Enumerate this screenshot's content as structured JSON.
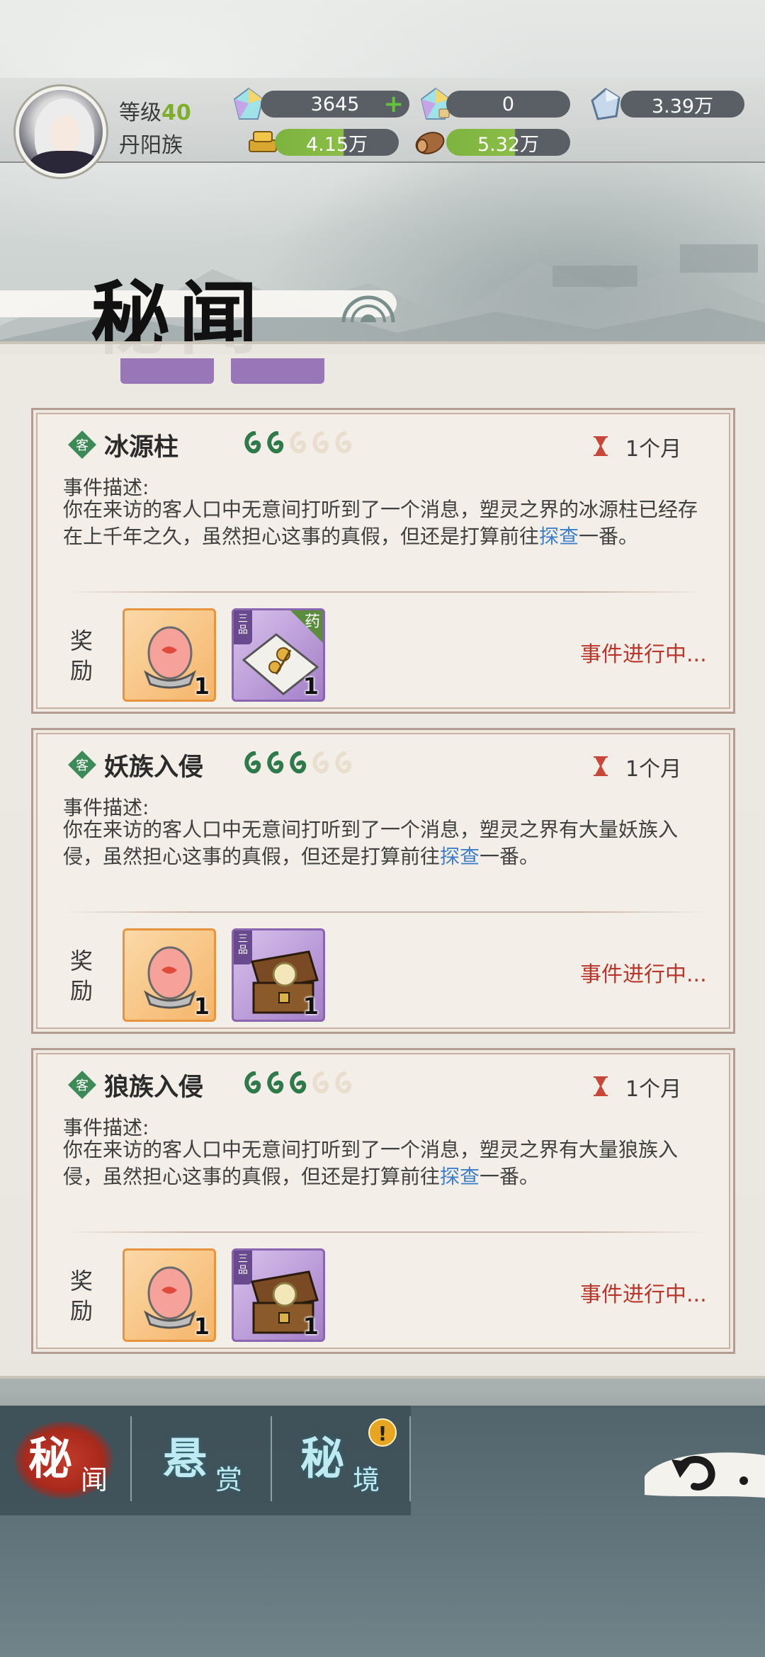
{
  "player": {
    "level_label": "等级",
    "level": "40",
    "clan": "丹阳族"
  },
  "resources": {
    "gem_blue": {
      "value": "3645",
      "icon": "crystal-icon",
      "action": "+"
    },
    "gem_locked": {
      "value": "0",
      "icon": "bound-crystal-icon"
    },
    "spirit_stone": {
      "value": "3.39万",
      "icon": "stone-icon"
    },
    "gold": {
      "value": "4.15万",
      "icon": "gold-ingot-icon"
    },
    "wood": {
      "value": "5.32万",
      "icon": "wood-icon"
    }
  },
  "page": {
    "title": "秘闻"
  },
  "events": [
    {
      "tag": "客",
      "title": "冰源柱",
      "difficulty": 2,
      "difficulty_max": 5,
      "duration": "1个月",
      "desc_label": "事件描述:",
      "desc_before": "你在来访的客人口中无意间打听到了一个消息，塑灵之界的冰源柱已经存在上千年之久，虽然担心这事的真假，但还是打算前往",
      "desc_link": "探查",
      "desc_after": "一番。",
      "reward_label": "奖励",
      "rewards": [
        {
          "type": "stone",
          "qty": "1"
        },
        {
          "type": "herb-bundle",
          "grade": "三品",
          "badge": "药",
          "qty": "1"
        }
      ],
      "status": "事件进行中..."
    },
    {
      "tag": "客",
      "title": "妖族入侵",
      "difficulty": 3,
      "difficulty_max": 5,
      "duration": "1个月",
      "desc_label": "事件描述:",
      "desc_before": "你在来访的客人口中无意间打听到了一个消息，塑灵之界有大量妖族入侵，虽然担心这事的真假，但还是打算前往",
      "desc_link": "探查",
      "desc_after": "一番。",
      "reward_label": "奖励",
      "rewards": [
        {
          "type": "stone",
          "qty": "1"
        },
        {
          "type": "treasure-chest",
          "grade": "三品",
          "qty": "1"
        }
      ],
      "status": "事件进行中..."
    },
    {
      "tag": "客",
      "title": "狼族入侵",
      "difficulty": 3,
      "difficulty_max": 5,
      "duration": "1个月",
      "desc_label": "事件描述:",
      "desc_before": "你在来访的客人口中无意间打听到了一个消息，塑灵之界有大量狼族入侵，虽然担心这事的真假，但还是打算前往",
      "desc_link": "探查",
      "desc_after": "一番。",
      "reward_label": "奖励",
      "rewards": [
        {
          "type": "stone",
          "qty": "1"
        },
        {
          "type": "treasure-chest",
          "grade": "三品",
          "qty": "1"
        }
      ],
      "status": "事件进行中..."
    }
  ],
  "tabs": [
    {
      "big": "秘",
      "small": "闻",
      "active": true
    },
    {
      "big": "悬",
      "small": "赏",
      "active": false
    },
    {
      "big": "秘",
      "small": "境",
      "active": false,
      "alert": "!"
    }
  ],
  "colors": {
    "status_red": "#b8362b",
    "link_blue": "#3f7fc7",
    "level_green": "#7fae2a",
    "tab_active_red": "#a8291c"
  }
}
